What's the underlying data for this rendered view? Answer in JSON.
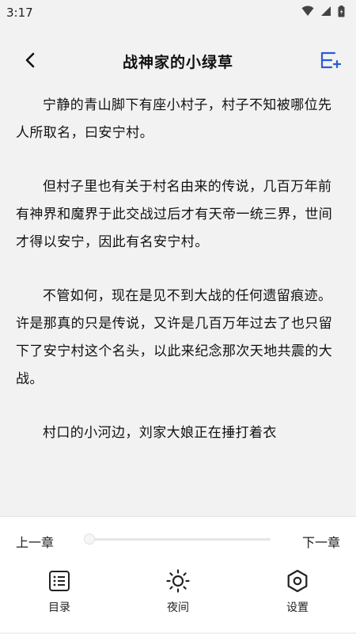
{
  "status_bar": {
    "time": "3:17",
    "icons": [
      "wifi-icon",
      "cell-signal-icon",
      "battery-icon"
    ]
  },
  "header": {
    "title": "战神家的小绿草",
    "back_icon": "chevron-left-icon",
    "add_icon": "add-to-shelf-icon",
    "accent_color": "#2a5bd7"
  },
  "content": {
    "paragraphs": [
      "宁静的青山脚下有座小村子，村子不知被哪位先人所取名，曰安宁村。",
      "但村子里也有关于村名由来的传说，几百万年前有神界和魔界于此交战过后才有天帝一统三界，世间才得以安宁，因此有名安宁村。",
      "不管如何，现在是见不到大战的任何遗留痕迹。许是那真的只是传说，又许是几百万年过去了也只留下了安宁村这个名头，以此来纪念那次天地共震的大战。",
      "村口的小河边，刘家大娘正在捶打着衣"
    ]
  },
  "bottom_bar": {
    "prev_chapter": "上一章",
    "next_chapter": "下一章",
    "progress": 0.0,
    "tabs": [
      {
        "label": "目录",
        "icon": "list-icon"
      },
      {
        "label": "夜间",
        "icon": "sun-icon"
      },
      {
        "label": "设置",
        "icon": "hexagon-settings-icon"
      }
    ]
  }
}
